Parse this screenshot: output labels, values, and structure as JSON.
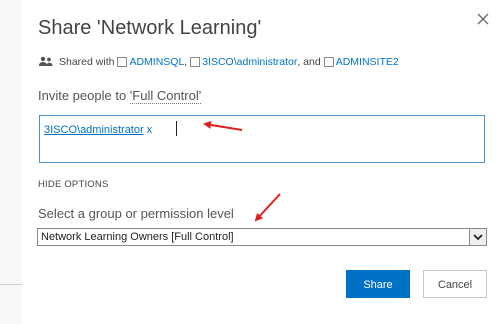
{
  "dialog": {
    "title": "Share 'Network Learning'",
    "close_icon": "close-icon"
  },
  "shared_with": {
    "icon": "people-icon",
    "prefix": "Shared with",
    "users": [
      "ADMINSQL",
      "3ISCO\\administrator",
      "ADMINSITE2"
    ],
    "sep1": ",",
    "sep2": ", and"
  },
  "invite": {
    "label_prefix": "Invite people to ",
    "permission": "'Full Control'",
    "chip_name": "3ISCO\\administrator",
    "chip_remove": "x"
  },
  "options": {
    "hide_options": "HIDE OPTIONS",
    "select_label": "Select a group or permission level",
    "selected_value": "Network Learning Owners [Full Control]"
  },
  "buttons": {
    "share": "Share",
    "cancel": "Cancel"
  },
  "colors": {
    "accent": "#0072c6",
    "annotation_arrow": "#e0201b"
  }
}
